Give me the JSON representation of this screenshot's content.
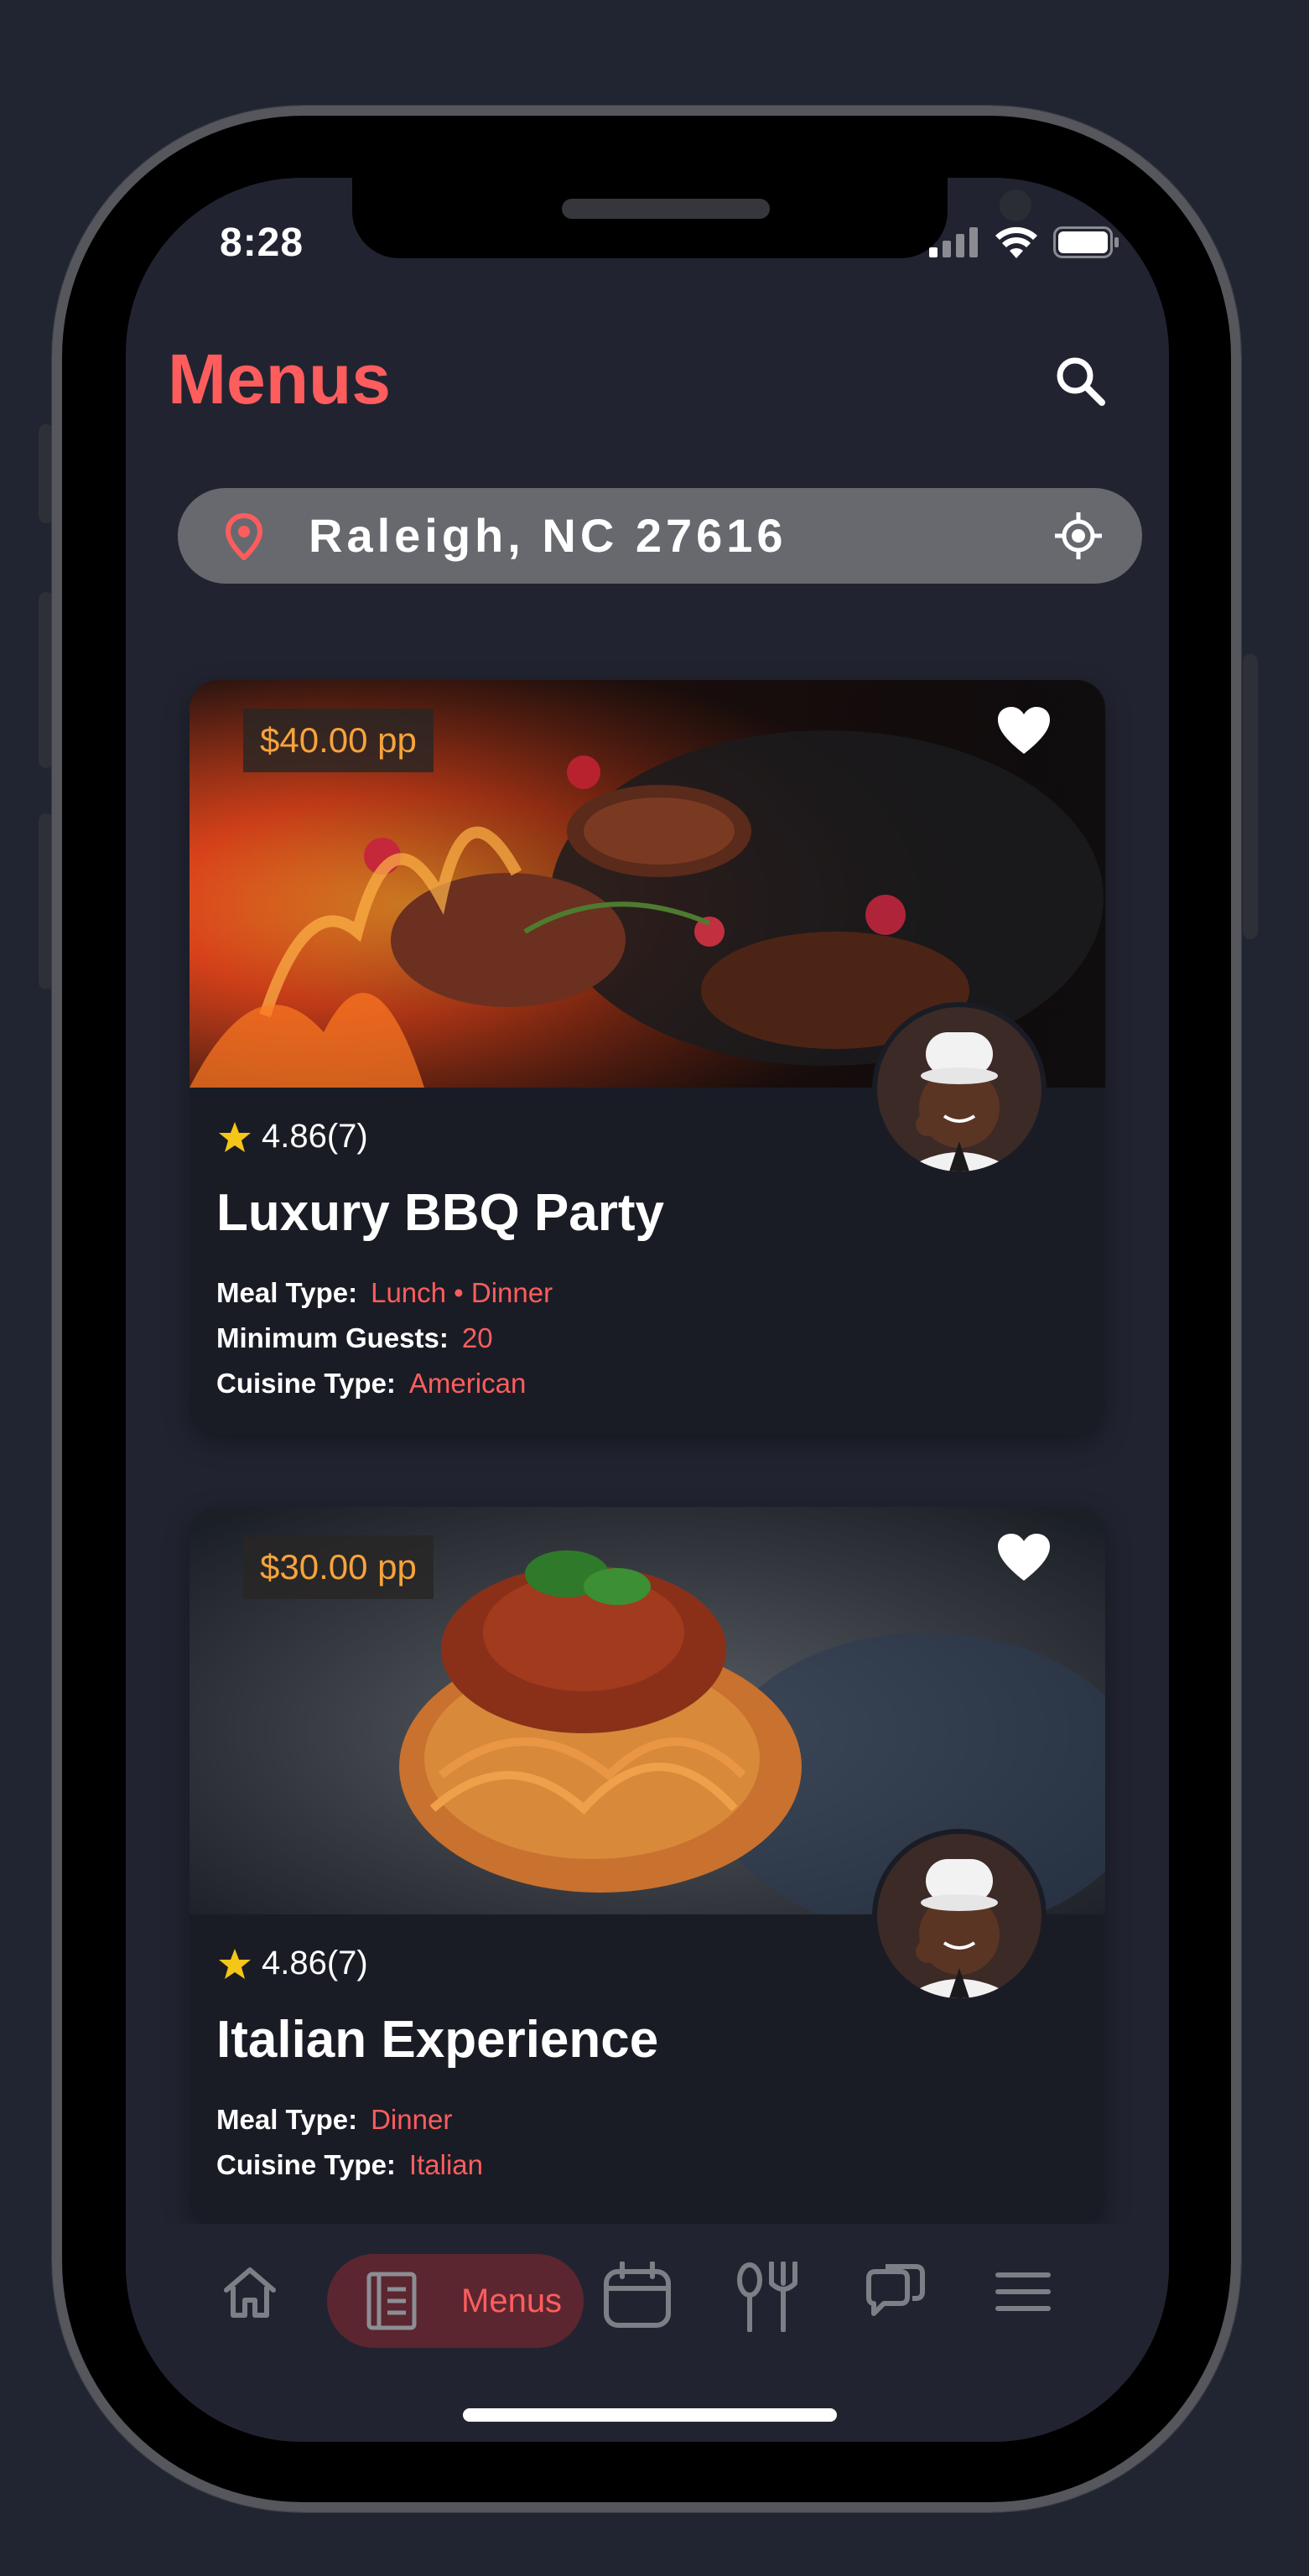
{
  "status_bar": {
    "time": "8:28"
  },
  "header": {
    "title": "Menus"
  },
  "location": {
    "text": "Raleigh, NC 27616"
  },
  "menus": [
    {
      "price": "$40.00 pp",
      "rating": "4.86(7)",
      "title": "Luxury BBQ Party",
      "meta": [
        {
          "key": "Meal Type:",
          "value": "Lunch • Dinner"
        },
        {
          "key": "Minimum Guests:",
          "value": "20"
        },
        {
          "key": "Cuisine Type:",
          "value": "American"
        }
      ]
    },
    {
      "price": "$30.00 pp",
      "rating": "4.86(7)",
      "title": "Italian Experience",
      "meta": [
        {
          "key": "Meal Type:",
          "value": "Dinner"
        },
        {
          "key": "Cuisine Type:",
          "value": "Italian"
        }
      ]
    }
  ],
  "bottom_nav": {
    "items": [
      "home-icon",
      "menus-icon",
      "calendar-icon",
      "utensils-icon",
      "chat-icon",
      "hamburger-menu-icon"
    ],
    "active_label": "Menus"
  },
  "colors": {
    "accent": "#ff5d5d",
    "price": "#f7a33b",
    "background": "#212430",
    "card": "#1a1c25",
    "star": "#f5c518"
  }
}
